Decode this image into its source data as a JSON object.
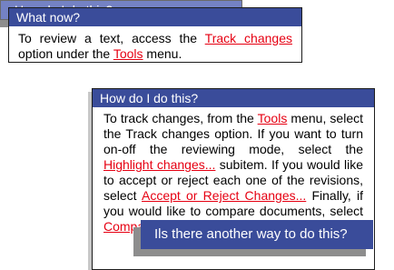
{
  "window1": {
    "title": "What now?",
    "text1": "To review a text, access the ",
    "link1": "Track changes",
    "text2": " option under the ",
    "link2": "Tools",
    "text3": " menu."
  },
  "window2": {
    "title": "How  do I do this?"
  },
  "window3": {
    "title": "How  do I do this?",
    "t1": "To track changes, from the ",
    "l1": "Tools",
    "t2": " menu, select the Track changes option. If you want to turn on-off the reviewing mode, select the ",
    "l2": "Highlight changes...",
    "t3": " subitem. If you would like to accept or reject each one of the revisions, select ",
    "l3": "Accept or Reject Changes...",
    "t4": " Finally, if you would like to compare documents, select ",
    "l4": "Compare Documents..."
  },
  "question_button": {
    "label": "Ils there another way to do this?"
  },
  "colors": {
    "title_bar": "#3a4c9a",
    "link": "#e60012"
  }
}
